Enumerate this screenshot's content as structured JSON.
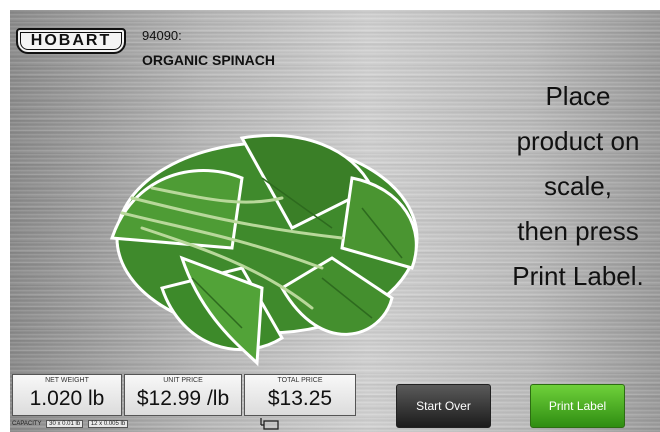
{
  "header": {
    "logo_text": "HOBART",
    "plu": "94090:",
    "product_name": "ORGANIC SPINACH"
  },
  "instruction": {
    "lines": [
      "Place",
      "product on",
      "scale,",
      "then press",
      "Print Label."
    ]
  },
  "readouts": {
    "net_weight": {
      "label": "NET WEIGHT",
      "value": "1.020 lb"
    },
    "unit_price": {
      "label": "UNIT PRICE",
      "value": "$12.99 /lb"
    },
    "total_price": {
      "label": "TOTAL PRICE",
      "value": "$13.25"
    }
  },
  "capacity": {
    "label": "CAPACITY",
    "range1": "30 x 0.01 lb",
    "range2": "12 x 0.005 lb"
  },
  "buttons": {
    "start_over": "Start Over",
    "print_label": "Print Label"
  },
  "colors": {
    "print_button": "#4caf27",
    "start_button": "#2e2e2e"
  },
  "icons": {
    "produce_image": "spinach-image",
    "scale": "scale-icon"
  }
}
